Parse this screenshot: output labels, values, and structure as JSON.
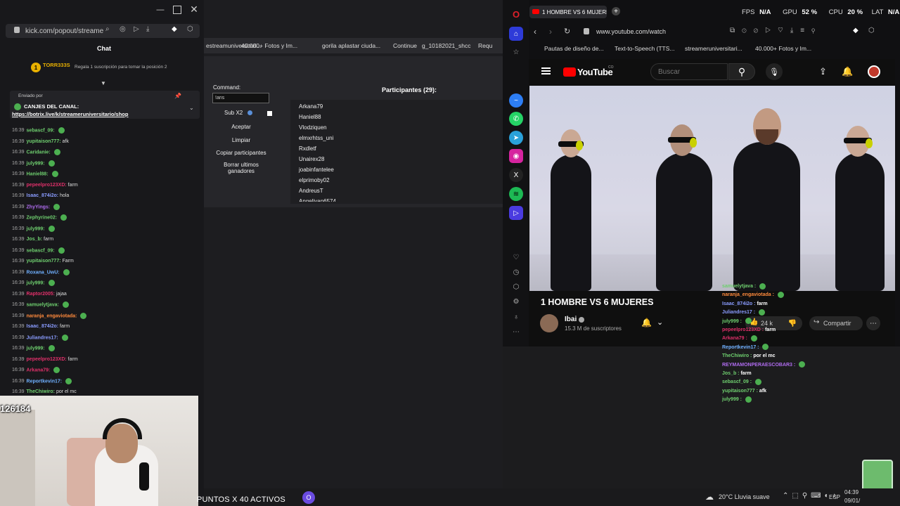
{
  "left_window": {
    "url": "kick.com/popout/streame",
    "chat_title": "Chat",
    "top_user": "TORR333S",
    "top_rank": "1",
    "top_note": "Regala 1 suscripción para tomar la posición 2",
    "pinned_sender": "Enviado por",
    "pinned_title": "CANJES DEL CANAL:",
    "pinned_link": "https://botrix.live/k/streameruniversitario/shop",
    "viewer_count": "126184",
    "messages": [
      {
        "time": "16:39",
        "user": "sebascf_09:",
        "color": "#6fcf6f",
        "msg": ""
      },
      {
        "time": "16:39",
        "user": "yupitaison777:",
        "color": "#6fcf6f",
        "msg": "afk"
      },
      {
        "time": "16:39",
        "user": "Caridanie:",
        "color": "#6fcf6f",
        "msg": ""
      },
      {
        "time": "16:39",
        "user": "july999:",
        "color": "#6fcf6f",
        "msg": ""
      },
      {
        "time": "16:39",
        "user": "Haniel88:",
        "color": "#6fcf6f",
        "msg": ""
      },
      {
        "time": "16:39",
        "user": "pepeelpro123XD:",
        "color": "#e0306a",
        "msg": "farm"
      },
      {
        "time": "16:39",
        "user": "Isaac_874i2o:",
        "color": "#8a9cff",
        "msg": "hola"
      },
      {
        "time": "16:39",
        "user": "ZhyYings:",
        "color": "#b06cf0",
        "msg": ""
      },
      {
        "time": "16:39",
        "user": "Zephyrine02:",
        "color": "#6fcf6f",
        "msg": ""
      },
      {
        "time": "16:39",
        "user": "july999:",
        "color": "#6fcf6f",
        "msg": ""
      },
      {
        "time": "16:39",
        "user": "Jos_b:",
        "color": "#6fcf6f",
        "msg": "farm"
      },
      {
        "time": "16:39",
        "user": "sebascf_09:",
        "color": "#6fcf6f",
        "msg": ""
      },
      {
        "time": "16:39",
        "user": "yupitaison777:",
        "color": "#6fcf6f",
        "msg": "Farm"
      },
      {
        "time": "16:39",
        "user": "Roxana_UwU:",
        "color": "#6fb0ff",
        "msg": ""
      },
      {
        "time": "16:39",
        "user": "july999:",
        "color": "#6fcf6f",
        "msg": ""
      },
      {
        "time": "16:39",
        "user": "Raptor2005:",
        "color": "#e0306a",
        "msg": "jajaa"
      },
      {
        "time": "16:39",
        "user": "samuelytjava:",
        "color": "#6fcf6f",
        "msg": ""
      },
      {
        "time": "16:39",
        "user": "naranja_engaviotada:",
        "color": "#ff8a3c",
        "msg": ""
      },
      {
        "time": "16:39",
        "user": "Isaac_874i2o:",
        "color": "#8a9cff",
        "msg": "farm"
      },
      {
        "time": "16:39",
        "user": "Juliandres17:",
        "color": "#8a9cff",
        "msg": ""
      },
      {
        "time": "16:39",
        "user": "july999:",
        "color": "#6fcf6f",
        "msg": ""
      },
      {
        "time": "16:39",
        "user": "pepeelpro123XD:",
        "color": "#e0306a",
        "msg": "farm"
      },
      {
        "time": "16:39",
        "user": "Arkana79:",
        "color": "#e0306a",
        "msg": ""
      },
      {
        "time": "16:39",
        "user": "Reportkevin17:",
        "color": "#6fb0ff",
        "msg": ""
      },
      {
        "time": "16:39",
        "user": "TheChiwiro:",
        "color": "#6fcf6f",
        "msg": "por el mc"
      }
    ]
  },
  "middle": {
    "bookmarks": [
      "estreamuniversitari...",
      "40.000+ Fotos y Im...",
      "gorila aplastar ciuda...",
      "Continue",
      "g_10182021_shcc",
      "Requ"
    ],
    "command_label": "Command:",
    "command_value": "!aris",
    "sub_label": "Sub X2",
    "buttons": [
      "Aceptar",
      "Limpiar",
      "Copiar participantes",
      "Borrar ultimos ganadores"
    ],
    "participants_title": "Participantes (29):",
    "participants": [
      "Arkana79",
      "Haniel88",
      "Vlodziquen",
      "elmxrhtss_uni",
      "Rxdletf",
      "Unairex28",
      "joabinfantelee",
      "elprimoby02",
      "AndreusT",
      "Angelivan6574"
    ],
    "active_points": "PUNTOS X 40 ACTIVOS"
  },
  "opera": {
    "tab_title": "1 HOMBRE VS 6 MUJERES",
    "fps_label": "FPS",
    "fps_value": "N/A",
    "gpu_label": "GPU",
    "gpu_value": "52 %",
    "cpu_label": "CPU",
    "cpu_value": "20 %",
    "lat_label": "LAT",
    "lat_value": "N/A",
    "url": "www.youtube.com/watch",
    "bookmarks": [
      "Pautas de diseño de...",
      "Text-to-Speech (TTS...",
      "streameruniversitari...",
      "40.000+ Fotos y Im..."
    ],
    "yt_logo": "YouTube",
    "yt_country": "CO",
    "search_placeholder": "Buscar",
    "video_title": "1 HOMBRE VS 6 MUJERES",
    "channel": "Ibai",
    "subscribers": "15.3 M de suscriptores",
    "likes": "24 k",
    "share": "Compartir"
  },
  "overlay_chat": [
    {
      "user": "samuelytjava :",
      "color": "#6fcf6f",
      "msg": ""
    },
    {
      "user": "naranja_engaviotada :",
      "color": "#ff8a3c",
      "msg": ""
    },
    {
      "user": "Isaac_874i2o :",
      "color": "#8a9cff",
      "msg": "farm"
    },
    {
      "user": "Juliandres17 :",
      "color": "#8a9cff",
      "msg": ""
    },
    {
      "user": "july999 :",
      "color": "#6fcf6f",
      "msg": ""
    },
    {
      "user": "pepeelpro123XD :",
      "color": "#e0306a",
      "msg": "farm"
    },
    {
      "user": "Arkana79 :",
      "color": "#e0306a",
      "msg": ""
    },
    {
      "user": "Reportkevin17 :",
      "color": "#6fb0ff",
      "msg": ""
    },
    {
      "user": "TheChiwiro :",
      "color": "#6fcf6f",
      "msg": "por el mc"
    },
    {
      "user": "REYMAMONPERAESCOBAR3 :",
      "color": "#b06cf0",
      "msg": ""
    },
    {
      "user": "Jos_b :",
      "color": "#6fcf6f",
      "msg": "farm"
    },
    {
      "user": "sebascf_09 :",
      "color": "#6fcf6f",
      "msg": ""
    },
    {
      "user": "yupitaison777 :",
      "color": "#6fcf6f",
      "msg": "afk"
    },
    {
      "user": "july999 :",
      "color": "#6fcf6f",
      "msg": ""
    }
  ],
  "taskbar": {
    "weather": "20°C Lluvia suave",
    "lang": "ESP",
    "time": "04:39",
    "date": "09/01/"
  }
}
